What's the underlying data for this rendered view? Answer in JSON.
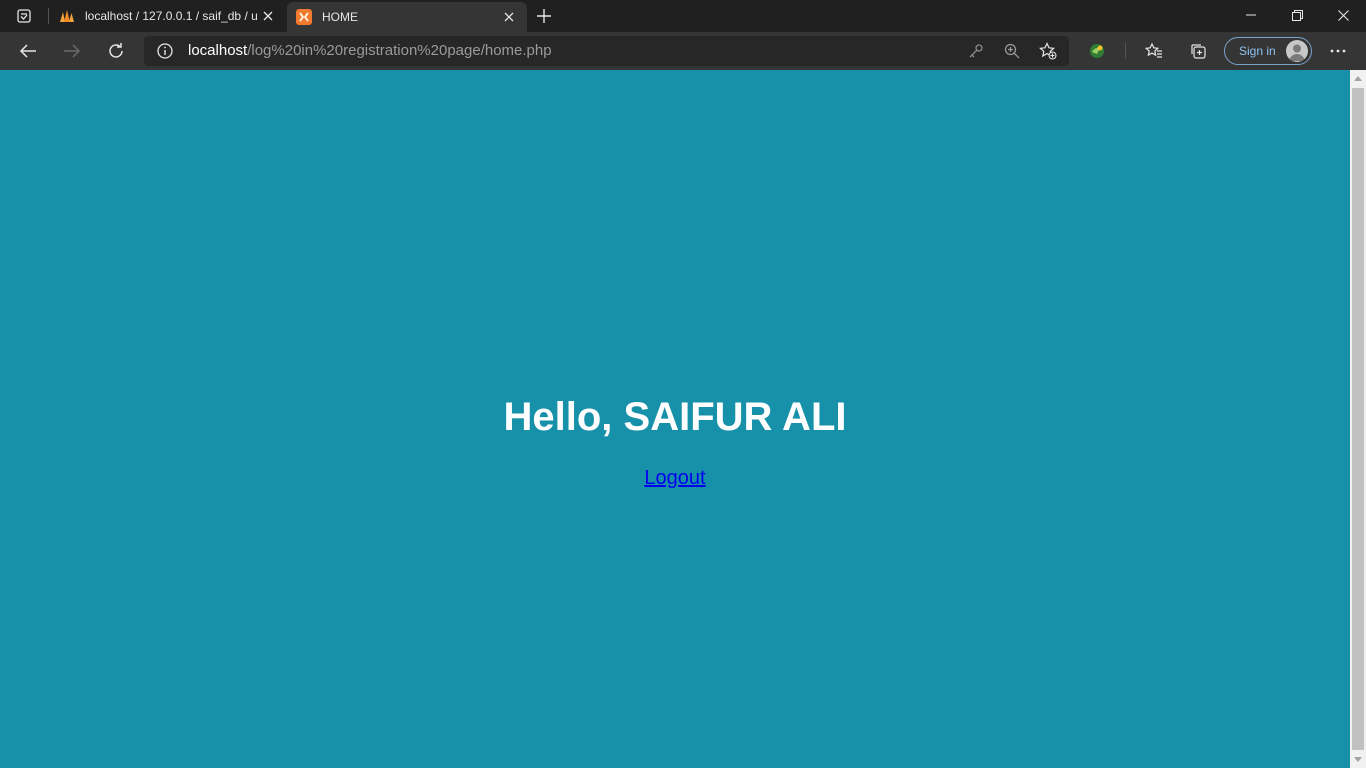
{
  "browser": {
    "tabs": [
      {
        "title": "localhost / 127.0.0.1 / saif_db / u",
        "favicon": "phpmyadmin-icon",
        "active": false
      },
      {
        "title": "HOME",
        "favicon": "xampp-icon",
        "active": true
      }
    ],
    "address": {
      "host": "localhost",
      "path": "/log%20in%20registration%20page/home.php"
    },
    "signin_label": "Sign in"
  },
  "page": {
    "background": "#1791a9",
    "greeting": "Hello, SAIFUR ALI",
    "logout_label": "Logout"
  }
}
